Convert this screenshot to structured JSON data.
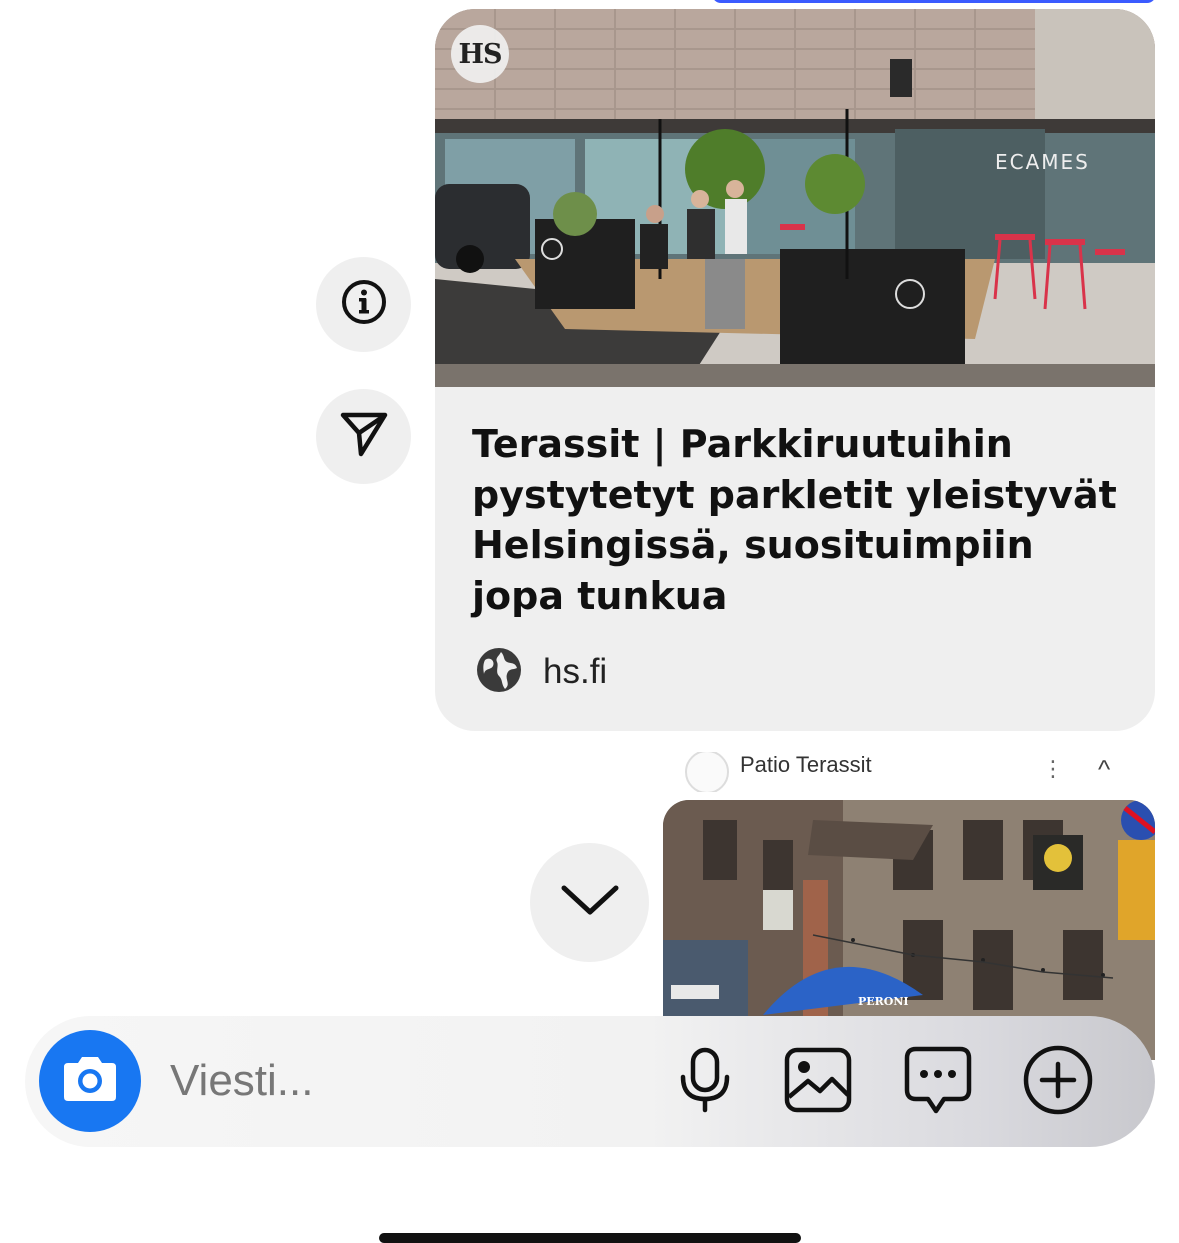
{
  "link_preview": {
    "publisher_badge": "HS",
    "title": "Terassit | Parkkiruutuihin pystytetyt parkletit yleistyvät Helsingissä, suosituimpiin jopa tunkua",
    "source": "hs.fi",
    "image_alt_text": "ECAMES"
  },
  "side_actions": {
    "info_icon": "info-icon",
    "share_icon": "send-icon"
  },
  "shared_post": {
    "author": "Patio Terassit",
    "more_icon": "more-icon",
    "close_icon": "chevron-up-icon",
    "image_sign_text": "PERONI"
  },
  "scroll_button_icon": "chevron-down-icon",
  "composer": {
    "placeholder": "Viesti...",
    "camera_icon": "camera-icon",
    "mic_icon": "microphone-icon",
    "gallery_icon": "gallery-icon",
    "sticker_icon": "chat-bubble-icon",
    "add_icon": "plus-icon",
    "camera_color": "#1877f2"
  }
}
